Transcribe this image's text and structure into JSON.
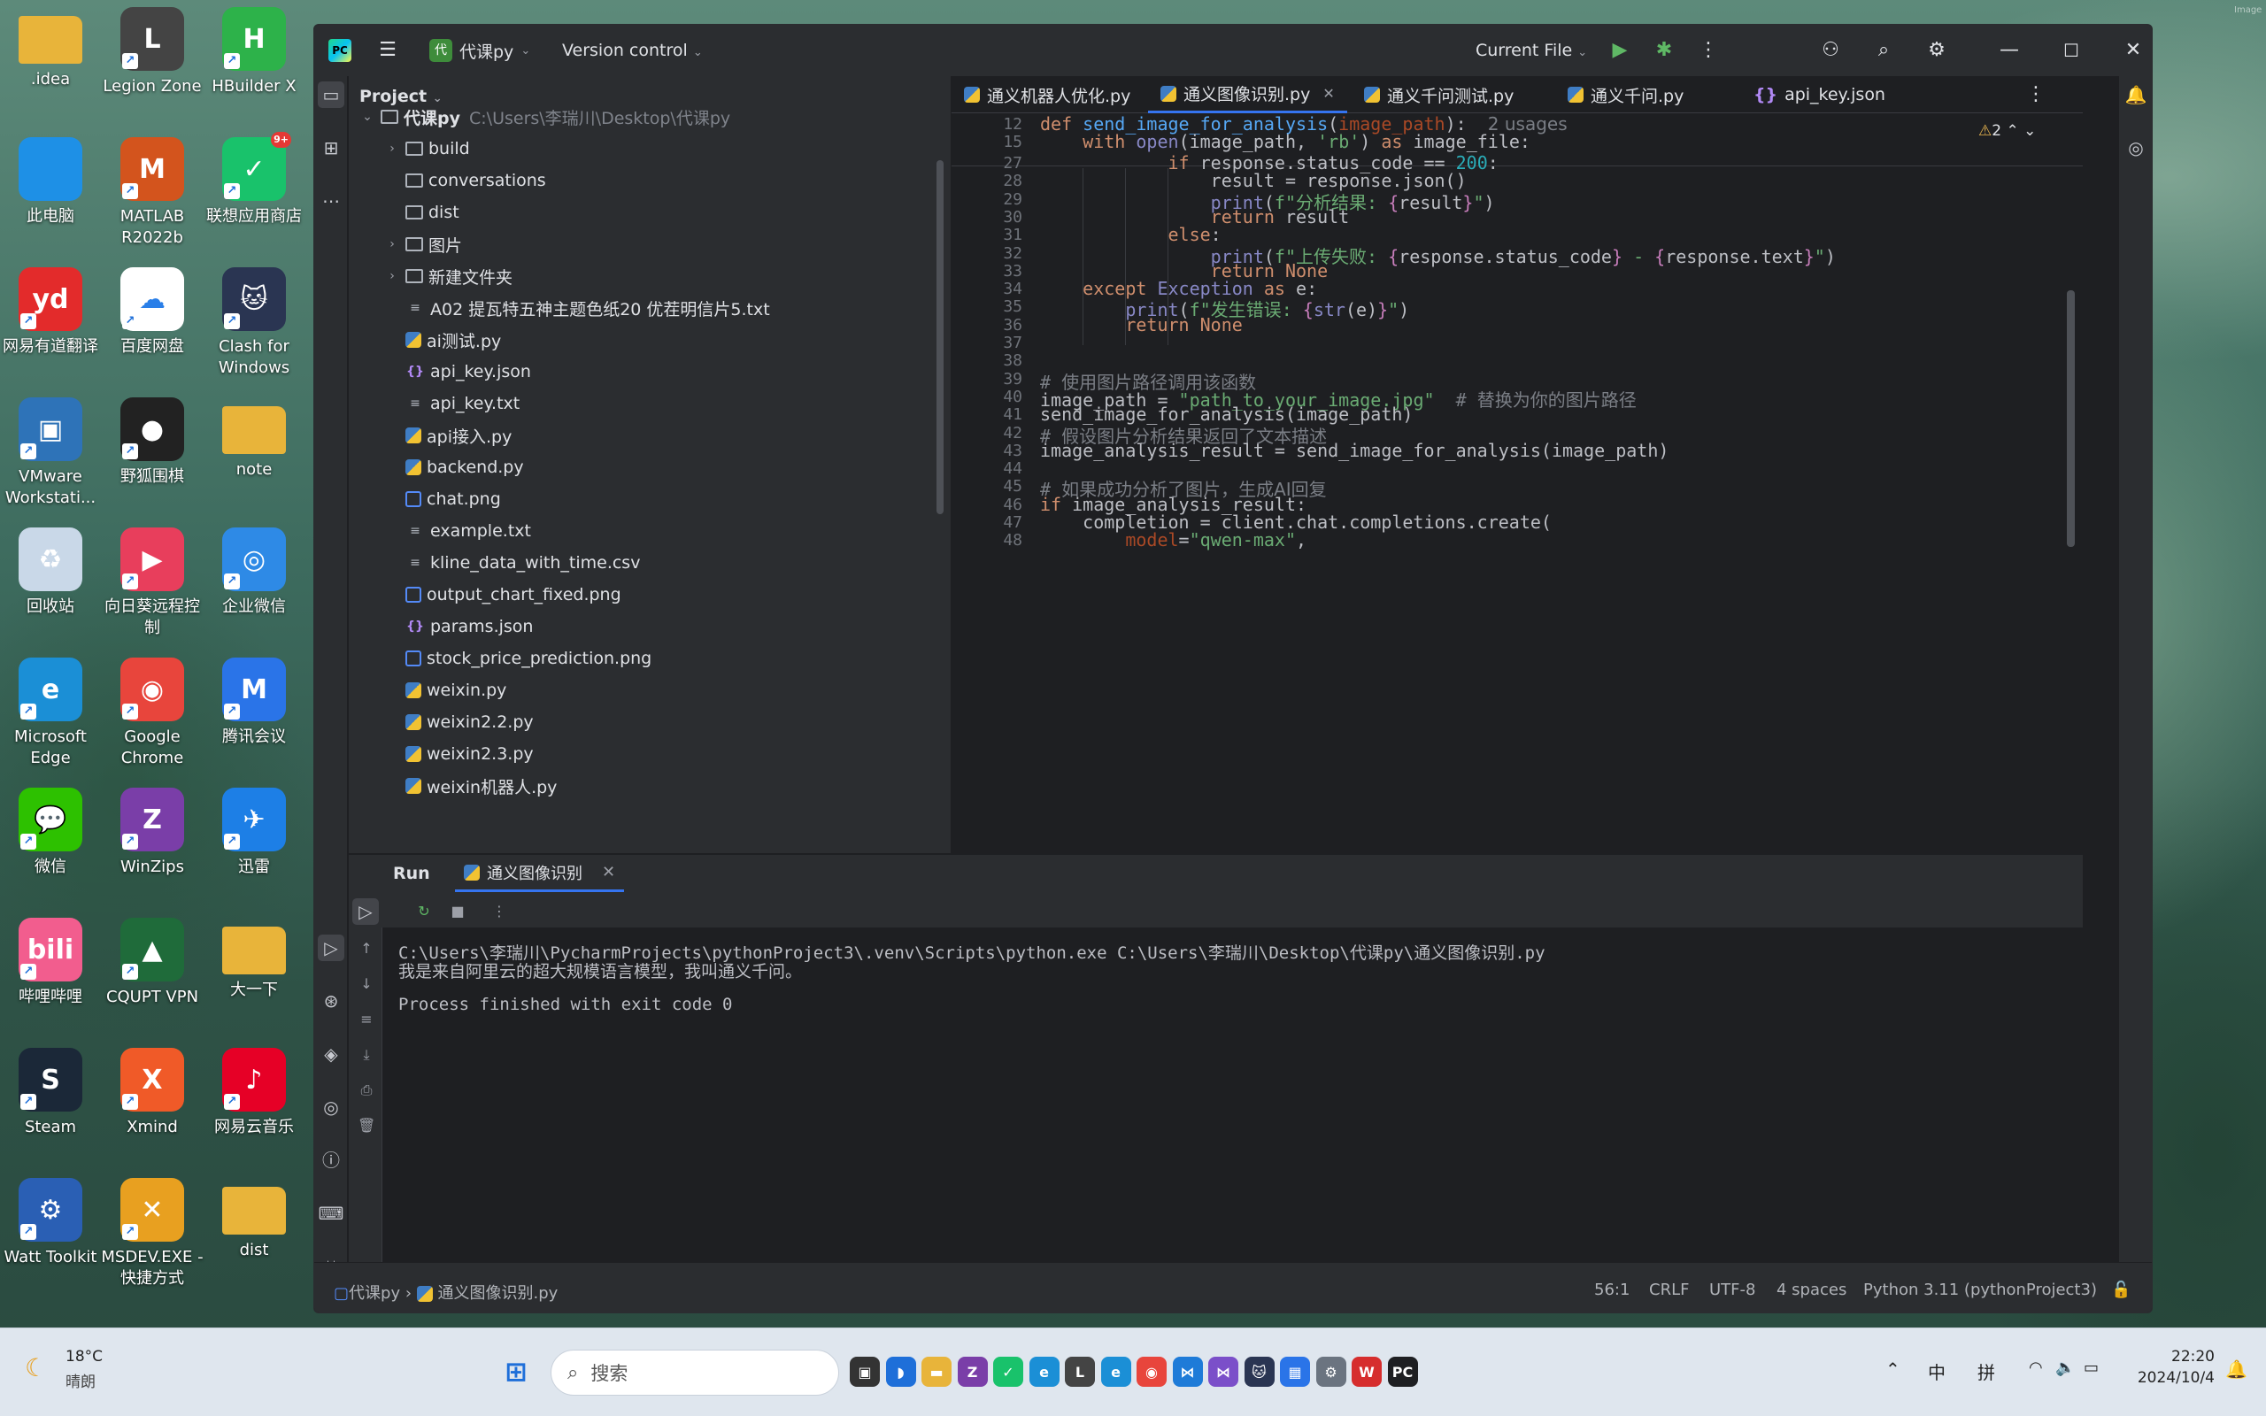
{
  "wallpaper_mark": "Image",
  "desktop_icons": [
    {
      "label": ".idea",
      "icon": "folder-icon",
      "color": "#e8b43a",
      "sc": false
    },
    {
      "label": "Legion Zone",
      "icon": "legion-icon",
      "color": "#444",
      "sc": true,
      "glyph": "L"
    },
    {
      "label": "HBuilder X",
      "icon": "hbuilder-icon",
      "color": "#2db24a",
      "sc": true,
      "glyph": "H"
    },
    {
      "label": "此电脑",
      "icon": "computer-icon",
      "color": "#1e90e6",
      "sc": false
    },
    {
      "label": "MATLAB R2022b",
      "icon": "matlab-icon",
      "color": "#d3541d",
      "sc": true,
      "glyph": "M"
    },
    {
      "label": "联想应用商店",
      "icon": "lenovo-store-icon",
      "color": "#19c26b",
      "sc": true,
      "glyph": "✓",
      "badge": "9+"
    },
    {
      "label": "网易有道翻译",
      "icon": "youdao-icon",
      "color": "#e32b2b",
      "sc": true,
      "glyph": "yd"
    },
    {
      "label": "百度网盘",
      "icon": "baidu-netdisk-icon",
      "color": "#ffffff",
      "sc": true,
      "glyph": "☁"
    },
    {
      "label": "Clash for Windows",
      "icon": "clash-icon",
      "color": "#2a3552",
      "sc": true,
      "glyph": "🐱"
    },
    {
      "label": "VMware Workstati...",
      "icon": "vmware-icon",
      "color": "#2e73b8",
      "sc": true,
      "glyph": "▣"
    },
    {
      "label": "野狐围棋",
      "icon": "foxwq-icon",
      "color": "#222",
      "sc": true,
      "glyph": "●"
    },
    {
      "label": "note",
      "icon": "folder-icon",
      "color": "#e8b43a",
      "sc": false
    },
    {
      "label": "回收站",
      "icon": "recycle-bin-icon",
      "color": "#c9d8e8",
      "sc": false,
      "glyph": "♻"
    },
    {
      "label": "向日葵远程控制",
      "icon": "sunlogin-icon",
      "color": "#e83e5c",
      "sc": true,
      "glyph": "▶"
    },
    {
      "label": "企业微信",
      "icon": "wecom-icon",
      "color": "#2e8ae6",
      "sc": true,
      "glyph": "◎"
    },
    {
      "label": "Microsoft Edge",
      "icon": "edge-icon",
      "color": "#1b8fd6",
      "sc": true,
      "glyph": "e"
    },
    {
      "label": "Google Chrome",
      "icon": "chrome-icon",
      "color": "#e8453c",
      "sc": true,
      "glyph": "◉"
    },
    {
      "label": "腾讯会议",
      "icon": "tencent-meeting-icon",
      "color": "#2a74e8",
      "sc": true,
      "glyph": "M"
    },
    {
      "label": "微信",
      "icon": "wechat-icon",
      "color": "#2dc100",
      "sc": true,
      "glyph": "💬"
    },
    {
      "label": "WinZips",
      "icon": "winzips-icon",
      "color": "#7a3ea8",
      "sc": true,
      "glyph": "Z"
    },
    {
      "label": "迅雷",
      "icon": "xunlei-icon",
      "color": "#1d7fe6",
      "sc": true,
      "glyph": "✈"
    },
    {
      "label": "哔哩哔哩",
      "icon": "bilibili-icon",
      "color": "#f25d8e",
      "sc": true,
      "glyph": "bili"
    },
    {
      "label": "CQUPT VPN",
      "icon": "vpn-icon",
      "color": "#1f6b3a",
      "sc": true,
      "glyph": "▲"
    },
    {
      "label": "大一下",
      "icon": "folder-icon",
      "color": "#e8b43a",
      "sc": false
    },
    {
      "label": "Steam",
      "icon": "steam-icon",
      "color": "#1b2838",
      "sc": true,
      "glyph": "S"
    },
    {
      "label": "Xmind",
      "icon": "xmind-icon",
      "color": "#f05a28",
      "sc": true,
      "glyph": "X"
    },
    {
      "label": "网易云音乐",
      "icon": "netease-music-icon",
      "color": "#e60026",
      "sc": true,
      "glyph": "♪"
    },
    {
      "label": "Watt Toolkit",
      "icon": "watt-toolkit-icon",
      "color": "#2a5fb4",
      "sc": true,
      "glyph": "⚙"
    },
    {
      "label": "MSDEV.EXE - 快捷方式",
      "icon": "msdev-icon",
      "color": "#e8a020",
      "sc": true,
      "glyph": "✕"
    },
    {
      "label": "dist",
      "icon": "folder-icon",
      "color": "#e8b43a",
      "sc": false
    }
  ],
  "ide": {
    "project_name": "代课py",
    "version_control": "Version control",
    "run_config": "Current File",
    "project_panel_title": "Project",
    "tree": [
      {
        "indent": 0,
        "chev": "⌄",
        "type": "folder",
        "name": "代课py",
        "path": "C:\\Users\\李瑞川\\Desktop\\代课py",
        "bold": true
      },
      {
        "indent": 1,
        "chev": "›",
        "type": "folder",
        "name": "build"
      },
      {
        "indent": 1,
        "chev": "",
        "type": "folder",
        "name": "conversations"
      },
      {
        "indent": 1,
        "chev": "",
        "type": "folder",
        "name": "dist"
      },
      {
        "indent": 1,
        "chev": "›",
        "type": "folder",
        "name": "图片"
      },
      {
        "indent": 1,
        "chev": "›",
        "type": "folder",
        "name": "新建文件夹"
      },
      {
        "indent": 1,
        "chev": "",
        "type": "txt",
        "name": "A02 提瓦特五神主题色纸20 优茬明信片5.txt"
      },
      {
        "indent": 1,
        "chev": "",
        "type": "py",
        "name": "ai测试.py"
      },
      {
        "indent": 1,
        "chev": "",
        "type": "json",
        "name": "api_key.json"
      },
      {
        "indent": 1,
        "chev": "",
        "type": "txt",
        "name": "api_key.txt"
      },
      {
        "indent": 1,
        "chev": "",
        "type": "py",
        "name": "api接入.py"
      },
      {
        "indent": 1,
        "chev": "",
        "type": "py",
        "name": "backend.py"
      },
      {
        "indent": 1,
        "chev": "",
        "type": "png",
        "name": "chat.png"
      },
      {
        "indent": 1,
        "chev": "",
        "type": "txt",
        "name": "example.txt"
      },
      {
        "indent": 1,
        "chev": "",
        "type": "txt",
        "name": "kline_data_with_time.csv"
      },
      {
        "indent": 1,
        "chev": "",
        "type": "png",
        "name": "output_chart_fixed.png"
      },
      {
        "indent": 1,
        "chev": "",
        "type": "json",
        "name": "params.json"
      },
      {
        "indent": 1,
        "chev": "",
        "type": "png",
        "name": "stock_price_prediction.png"
      },
      {
        "indent": 1,
        "chev": "",
        "type": "py",
        "name": "weixin.py"
      },
      {
        "indent": 1,
        "chev": "",
        "type": "py",
        "name": "weixin2.2.py"
      },
      {
        "indent": 1,
        "chev": "",
        "type": "py",
        "name": "weixin2.3.py"
      },
      {
        "indent": 1,
        "chev": "",
        "type": "py",
        "name": "weixin机器人.py"
      }
    ],
    "tabs": [
      {
        "label": "通义机器人优化.py",
        "type": "py",
        "active": false
      },
      {
        "label": "通义图像识别.py",
        "type": "py",
        "active": true
      },
      {
        "label": "通义千问测试.py",
        "type": "py",
        "active": false
      },
      {
        "label": "通义千问.py",
        "type": "py",
        "active": false
      },
      {
        "label": "api_key.json",
        "type": "json",
        "active": false
      }
    ],
    "sticky": [
      {
        "n": "12",
        "html": "<span class='kw'>def</span> <span class='fn'>send_image_for_analysis</span>(<span class='pa'>image_path</span>):  <span class='cm cjk'>2 usages</span>"
      },
      {
        "n": "15",
        "html": "    <span class='kw'>with</span> <span class='bi'>open</span>(image_path, <span class='st'>'rb'</span>) <span class='kw'>as</span> image_file:"
      }
    ],
    "code": [
      {
        "n": "27",
        "html": "            <span class='kw'>if</span> response.status_code == <span class='nm'>200</span>:"
      },
      {
        "n": "28",
        "html": "                result = response.json()"
      },
      {
        "n": "29",
        "html": "                <span class='bi'>print</span>(<span class='st'>f\"<span class='cjk'>分析结果</span>: </span><span class='fs'>{</span>result<span class='fs'>}</span><span class='st'>\"</span>)"
      },
      {
        "n": "30",
        "html": "                <span class='kw'>return</span> result"
      },
      {
        "n": "31",
        "html": "            <span class='kw'>else</span>:"
      },
      {
        "n": "32",
        "html": "                <span class='bi'>print</span>(<span class='st'>f\"<span class='cjk'>上传失败</span>: </span><span class='fs'>{</span>response.status_code<span class='fs'>}</span><span class='st'> - </span><span class='fs'>{</span>response.text<span class='fs'>}</span><span class='st'>\"</span>)"
      },
      {
        "n": "33",
        "html": "                <span class='kw'>return None</span>"
      },
      {
        "n": "34",
        "html": "    <span class='kw'>except</span> <span class='bi'>Exception</span> <span class='kw'>as</span> e:"
      },
      {
        "n": "35",
        "html": "        <span class='bi'>print</span>(<span class='st'>f\"<span class='cjk'>发生错误</span>: </span><span class='fs'>{</span><span class='bi'>str</span>(e)<span class='fs'>}</span><span class='st'>\"</span>)"
      },
      {
        "n": "36",
        "html": "        <span class='kw'>return None</span>"
      },
      {
        "n": "37",
        "html": ""
      },
      {
        "n": "38",
        "html": ""
      },
      {
        "n": "39",
        "html": "<span class='cm'># <span class='cjk'>使用图片路径调用该函数</span></span>"
      },
      {
        "n": "40",
        "html": "image_path = <span class='st'>\"path_to_your_image.jpg\"</span>  <span class='cm'># <span class='cjk'>替换为你的图片路径</span></span>"
      },
      {
        "n": "41",
        "html": "send_image_for_analysis(image_path)"
      },
      {
        "n": "42",
        "html": "<span class='cm'># <span class='cjk'>假设图片分析结果返回了文本描述</span></span>"
      },
      {
        "n": "43",
        "html": "image_analysis_result = send_image_for_analysis(image_path)"
      },
      {
        "n": "44",
        "html": ""
      },
      {
        "n": "45",
        "html": "<span class='cm'># <span class='cjk'>如果成功分析了图片，生成AI回复</span></span>"
      },
      {
        "n": "46",
        "html": "<span class='kw'>if</span> image_analysis_result:"
      },
      {
        "n": "47",
        "html": "    completion = client.chat.completions.create("
      },
      {
        "n": "48",
        "html": "        <span class='pa'>model</span>=<span class='st'>\"qwen-max\"</span>,"
      }
    ],
    "warnings": "2",
    "run": {
      "title": "Run",
      "tab": "通义图像识别",
      "output": [
        "C:\\Users\\李瑞川\\PycharmProjects\\pythonProject3\\.venv\\Scripts\\python.exe C:\\Users\\李瑞川\\Desktop\\代课py\\通义图像识别.py",
        "我是来自阿里云的超大规模语言模型，我叫通义千问。",
        "",
        "Process finished with exit code 0"
      ]
    },
    "status": {
      "crumb_project": "代课py",
      "crumb_file": "通义图像识别.py",
      "position": "56:1",
      "line_sep": "CRLF",
      "encoding": "UTF-8",
      "indent": "4 spaces",
      "interpreter": "Python 3.11 (pythonProject3)"
    }
  },
  "taskbar": {
    "weather_temp": "18°C",
    "weather_desc": "晴朗",
    "search_placeholder": "搜索",
    "ime_mode": "中",
    "ime_kind": "拼",
    "time": "22:20",
    "date": "2024/10/4"
  }
}
